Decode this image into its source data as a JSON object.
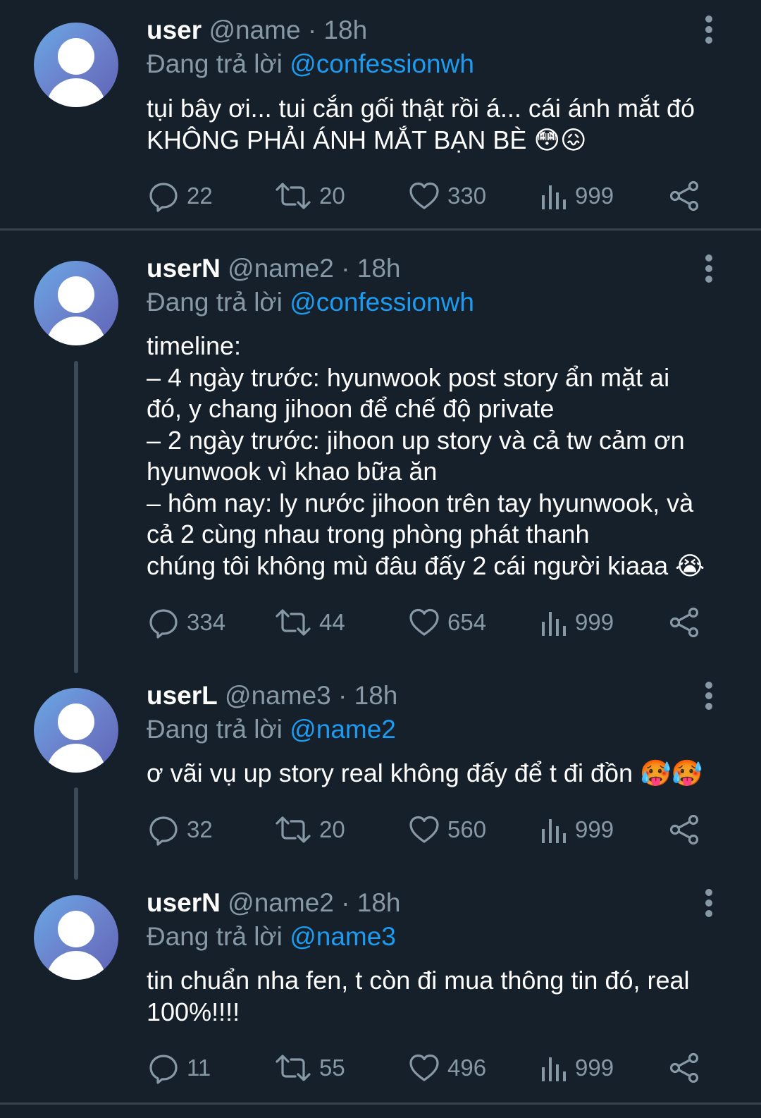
{
  "tweets": [
    {
      "username": "user",
      "handle": "@name · 18h",
      "reply_prefix": "Đang trả lời ",
      "reply_to": "@confessionwh",
      "text": "tụi bây ơi... tui cắn gối thật rồi á... cái ánh mắt đó\nKHÔNG PHẢI ÁNH MẮT BẠN BÈ 😳😖",
      "replies": "22",
      "retweets": "20",
      "likes": "330",
      "views": "999"
    },
    {
      "username": "userN",
      "handle": "@name2 · 18h",
      "reply_prefix": "Đang trả lời ",
      "reply_to": "@confessionwh",
      "text": "timeline:\n– 4 ngày trước: hyunwook post story ẩn mặt ai\nđó, y chang jihoon để chế độ private\n– 2 ngày trước: jihoon up story và cả tw cảm ơn\nhyunwook vì khao bữa ăn\n– hôm nay: ly nước jihoon trên tay hyunwook, và\ncả 2 cùng nhau trong phòng phát thanh\nchúng tôi không mù đâu đấy 2 cái người kiaaa 😭",
      "replies": "334",
      "retweets": "44",
      "likes": "654",
      "views": "999"
    },
    {
      "username": "userL",
      "handle": "@name3 · 18h",
      "reply_prefix": "Đang trả lời ",
      "reply_to": "@name2",
      "text": "ơ vãi vụ up story real không đấy để t đi đồn 🥵🥵",
      "replies": "32",
      "retweets": "20",
      "likes": "560",
      "views": "999"
    },
    {
      "username": "userN",
      "handle": "@name2 · 18h",
      "reply_prefix": "Đang trả lời ",
      "reply_to": "@name3",
      "text": "tin chuẩn nha fen, t còn đi mua thông tin đó, real\n100%!!!!",
      "replies": "11",
      "retweets": "55",
      "likes": "496",
      "views": "999"
    }
  ],
  "icons": {
    "reply": "reply-icon",
    "retweet": "retweet-icon",
    "like": "heart-icon",
    "views": "views-icon",
    "share": "share-icon",
    "more": "more-vertical-icon",
    "avatar": "default-avatar"
  },
  "colors": {
    "background": "#15202b",
    "text": "#ffffff",
    "muted": "#8899a6",
    "mention": "#1d9bf0",
    "divider": "#38444d"
  }
}
